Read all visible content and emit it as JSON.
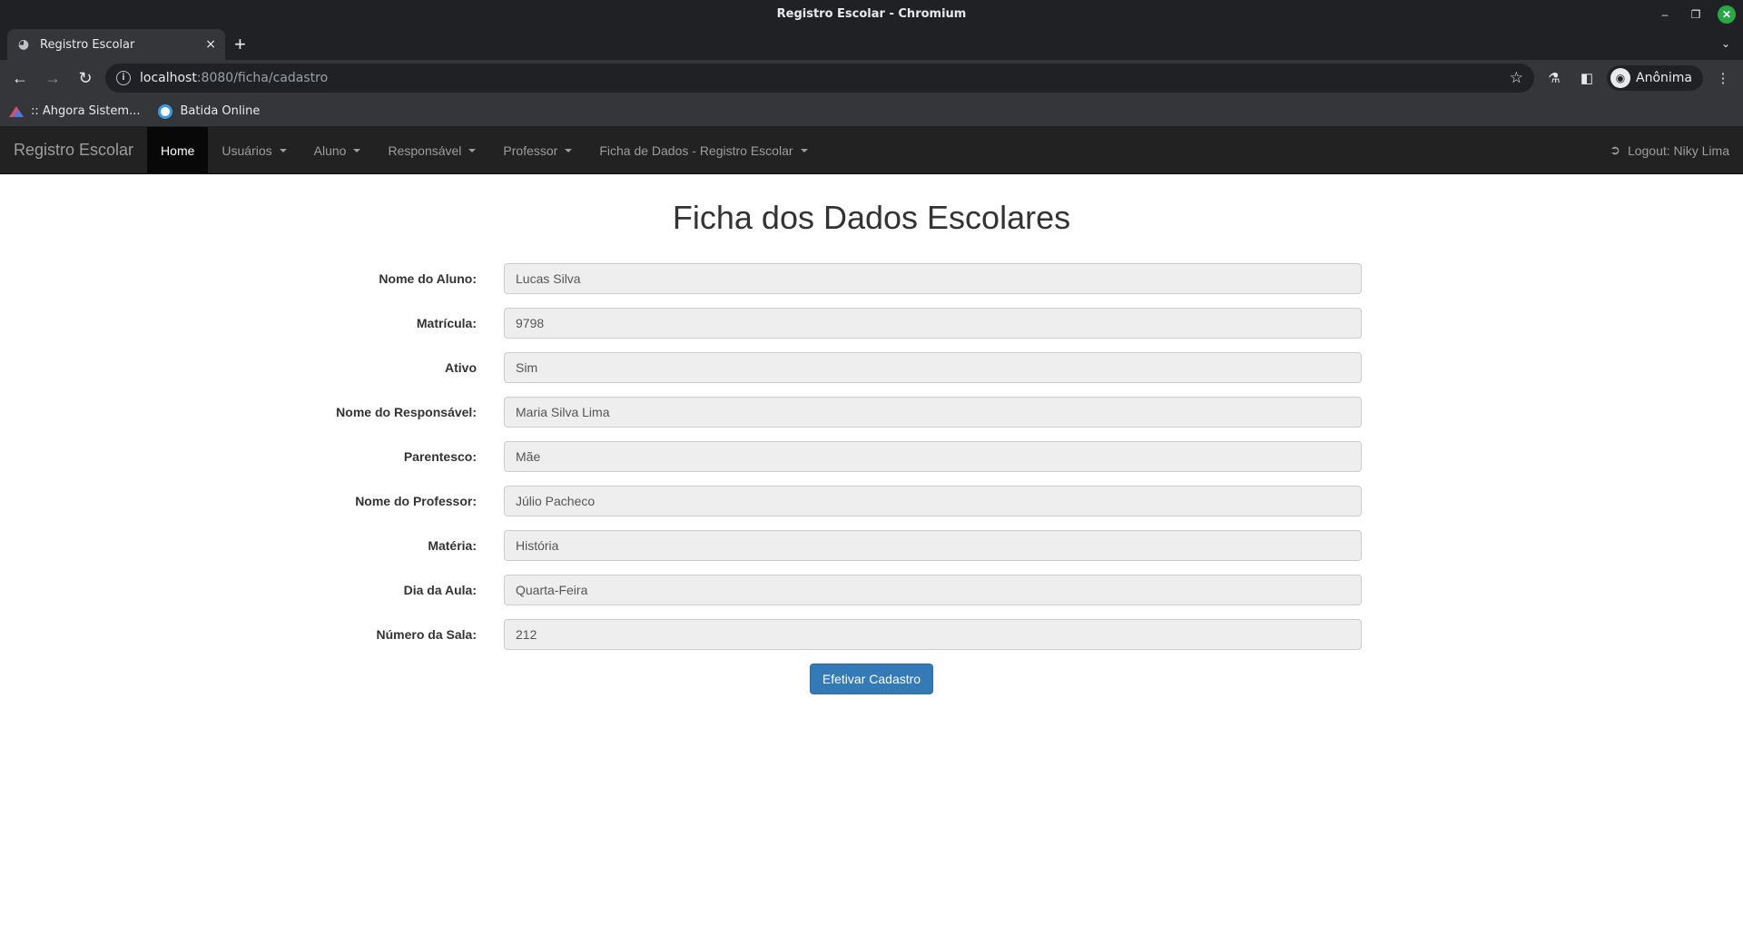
{
  "window": {
    "title": "Registro Escolar - Chromium"
  },
  "tab": {
    "title": "Registro Escolar",
    "close": "×",
    "new": "+"
  },
  "omnibox": {
    "host": "localhost",
    "rest": ":8080/ficha/cadastro"
  },
  "profile": {
    "label": "Anônima"
  },
  "bookmarks": [
    {
      "label": ":: Ahgora Sistem..."
    },
    {
      "label": "Batida Online"
    }
  ],
  "navbar": {
    "brand": "Registro Escolar",
    "items": [
      {
        "label": "Home"
      },
      {
        "label": "Usuários"
      },
      {
        "label": "Aluno"
      },
      {
        "label": "Responsável"
      },
      {
        "label": "Professor"
      },
      {
        "label": "Ficha de Dados - Registro Escolar"
      }
    ],
    "logout": "Logout: Niky Lima"
  },
  "page": {
    "title": "Ficha dos Dados Escolares"
  },
  "form": {
    "fields": [
      {
        "label": "Nome do Aluno:",
        "value": "Lucas Silva"
      },
      {
        "label": "Matrícula:",
        "value": "9798"
      },
      {
        "label": "Ativo",
        "value": "Sim"
      },
      {
        "label": "Nome do Responsável:",
        "value": "Maria Silva Lima"
      },
      {
        "label": "Parentesco:",
        "value": "Mãe"
      },
      {
        "label": "Nome do Professor:",
        "value": "Júlio Pacheco"
      },
      {
        "label": "Matéria:",
        "value": "História"
      },
      {
        "label": "Dia da Aula:",
        "value": "Quarta-Feira"
      },
      {
        "label": "Número da Sala:",
        "value": "212"
      }
    ],
    "submit_label": "Efetivar Cadastro"
  },
  "colors": {
    "navbar_bg": "#222222",
    "primary": "#337ab7",
    "field_bg": "#eeeeee"
  }
}
